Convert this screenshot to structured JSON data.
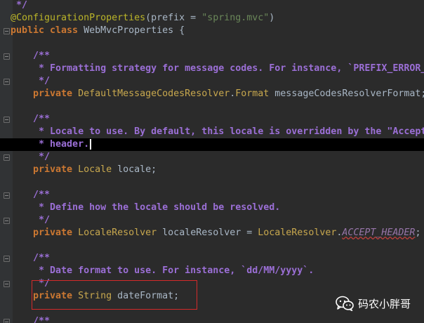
{
  "editor": {
    "lines": [
      [
        {
          "c": "dc",
          "t": " */"
        }
      ],
      [
        {
          "c": "an",
          "t": "@ConfigurationProperties"
        },
        {
          "c": "pl",
          "t": "(prefix = "
        },
        {
          "c": "str",
          "t": "\"spring.mvc\""
        },
        {
          "c": "pl",
          "t": ")"
        }
      ],
      [
        {
          "c": "k",
          "t": "public class "
        },
        {
          "c": "pl",
          "t": "WebMvcProperties {"
        }
      ],
      [],
      [
        {
          "c": "dc",
          "t": "    /**"
        }
      ],
      [
        {
          "c": "dc",
          "t": "     * Formatting strategy for message codes. For instance, `PREFIX_ERROR_"
        }
      ],
      [
        {
          "c": "dc",
          "t": "     */"
        }
      ],
      [
        {
          "c": "k",
          "t": "    private "
        },
        {
          "c": "t",
          "t": "DefaultMessageCodesResolver"
        },
        {
          "c": "pl",
          "t": "."
        },
        {
          "c": "t",
          "t": "Format "
        },
        {
          "c": "pl",
          "t": "messageCodesResolverFormat;"
        }
      ],
      [],
      [
        {
          "c": "dc",
          "t": "    /**"
        }
      ],
      [
        {
          "c": "dc",
          "t": "     * Locale to use. By default, this locale is overridden by the \"Accept"
        }
      ],
      [
        {
          "c": "dc",
          "t": "     * header."
        }
      ],
      [
        {
          "c": "dc",
          "t": "     */"
        }
      ],
      [
        {
          "c": "k",
          "t": "    private "
        },
        {
          "c": "t",
          "t": "Locale "
        },
        {
          "c": "pl",
          "t": "locale;"
        }
      ],
      [],
      [
        {
          "c": "dc",
          "t": "    /**"
        }
      ],
      [
        {
          "c": "dc",
          "t": "     * Define how the locale should be resolved."
        }
      ],
      [
        {
          "c": "dc",
          "t": "     */"
        }
      ],
      [
        {
          "c": "k",
          "t": "    private "
        },
        {
          "c": "t",
          "t": "LocaleResolver "
        },
        {
          "c": "pl",
          "t": "localeResolver = "
        },
        {
          "c": "t",
          "t": "LocaleResolver"
        },
        {
          "c": "pl",
          "t": "."
        },
        {
          "c": "constref",
          "t": "ACCEPT_HEADER"
        },
        {
          "c": "pl",
          "t": ";"
        }
      ],
      [],
      [
        {
          "c": "dc",
          "t": "    /**"
        }
      ],
      [
        {
          "c": "dc",
          "t": "     * Date format to use. For instance, `dd/MM/yyyy`."
        }
      ],
      [
        {
          "c": "dc",
          "t": "     */"
        }
      ],
      [
        {
          "c": "k",
          "t": "    private "
        },
        {
          "c": "t",
          "t": "String "
        },
        {
          "c": "pl",
          "t": "dateFormat;"
        }
      ],
      [],
      [
        {
          "c": "dc",
          "t": "    /**"
        }
      ]
    ],
    "current_line": 11,
    "fold_markers": [
      2,
      4,
      6,
      9,
      12,
      15,
      17,
      20,
      22,
      25
    ]
  },
  "watermark": {
    "text": "码农小胖哥",
    "icon": "wechat-icon"
  },
  "colors": {
    "background": "#2b2b2b",
    "keyword": "#cc7832",
    "type": "#c8a84e",
    "doc_comment": "#9b6fd6",
    "annotation": "#bbb529",
    "string": "#6a8759",
    "highlight_box": "#d42a2a"
  }
}
